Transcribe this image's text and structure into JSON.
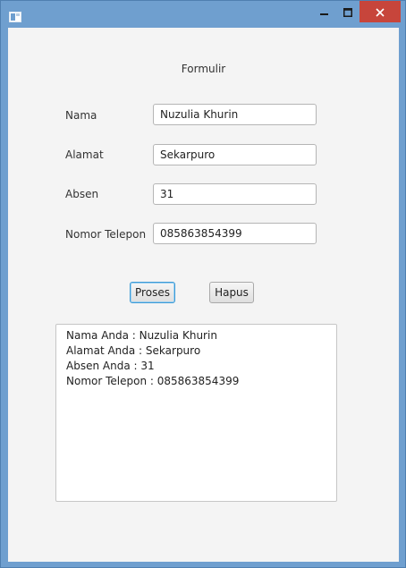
{
  "window": {
    "title": "",
    "close_color": "#c7453b",
    "frame_color": "#6f9fcf",
    "icons": [
      "app-window-icon",
      "minimize-icon",
      "maximize-icon",
      "close-icon"
    ]
  },
  "form": {
    "title": "Formulir",
    "fields": [
      {
        "label": "Nama",
        "value": "Nuzulia Khurin"
      },
      {
        "label": "Alamat",
        "value": "Sekarpuro"
      },
      {
        "label": "Absen",
        "value": "31"
      },
      {
        "label": "Nomor Telepon",
        "value": "085863854399"
      }
    ]
  },
  "buttons": {
    "proses_label": "Proses",
    "hapus_label": "Hapus"
  },
  "output": {
    "lines": [
      "Nama Anda : Nuzulia Khurin",
      "Alamat Anda : Sekarpuro",
      "Absen Anda : 31",
      "Nomor Telepon : 085863854399"
    ]
  }
}
